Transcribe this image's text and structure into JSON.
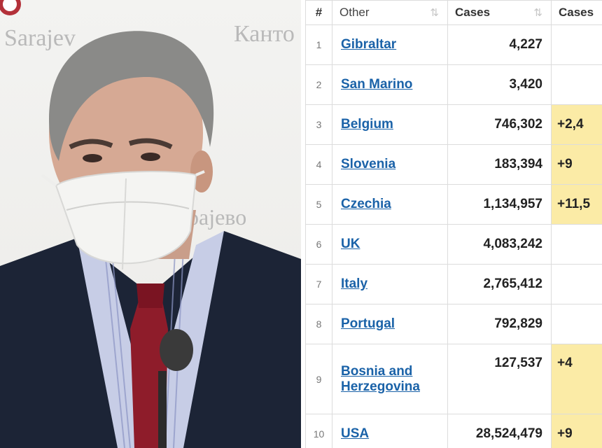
{
  "photo": {
    "wall_text_left": "Sarajev",
    "wall_text_right": "Канто",
    "wall_text_lower": "рајево"
  },
  "table": {
    "columns": [
      "#",
      "Other",
      "Cases",
      "Cases"
    ],
    "sort_icon": "sort-arrows-icon",
    "highlight_color": "#fbeba6",
    "link_color": "#1a62a8",
    "rows": [
      {
        "num": "1",
        "country": "Gibraltar",
        "cases": "4,227",
        "new": "",
        "highlight": false
      },
      {
        "num": "2",
        "country": "San Marino",
        "cases": "3,420",
        "new": "",
        "highlight": false
      },
      {
        "num": "3",
        "country": "Belgium",
        "cases": "746,302",
        "new": "+2,4",
        "highlight": true
      },
      {
        "num": "4",
        "country": "Slovenia",
        "cases": "183,394",
        "new": "+9",
        "highlight": true
      },
      {
        "num": "5",
        "country": "Czechia",
        "cases": "1,134,957",
        "new": "+11,5",
        "highlight": true
      },
      {
        "num": "6",
        "country": "UK",
        "cases": "4,083,242",
        "new": "",
        "highlight": false
      },
      {
        "num": "7",
        "country": "Italy",
        "cases": "2,765,412",
        "new": "",
        "highlight": false
      },
      {
        "num": "8",
        "country": "Portugal",
        "cases": "792,829",
        "new": "",
        "highlight": false
      },
      {
        "num": "9",
        "country": "Bosnia and Herzegovina",
        "cases": "127,537",
        "new": "+4",
        "highlight": true
      },
      {
        "num": "10",
        "country": "USA",
        "cases": "28,524,479",
        "new": "+9",
        "highlight": true
      }
    ]
  }
}
